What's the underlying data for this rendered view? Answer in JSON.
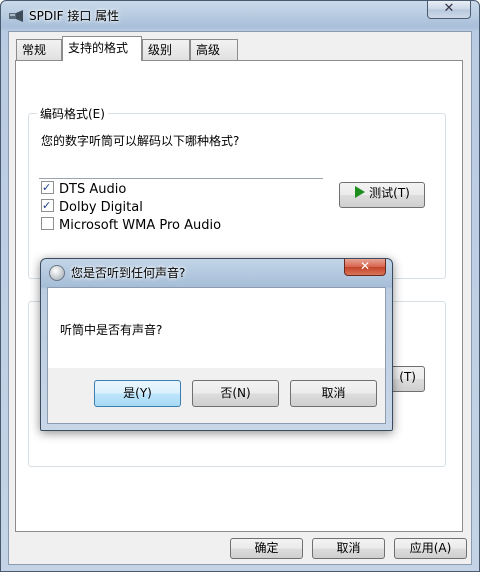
{
  "window": {
    "title": "SPDIF 接口 属性",
    "close_glyph": "✕"
  },
  "tabs": [
    {
      "label": "常规"
    },
    {
      "label": "支持的格式"
    },
    {
      "label": "级别"
    },
    {
      "label": "高级"
    }
  ],
  "encoding_group": {
    "label": "编码格式(E)",
    "prompt": "您的数字听筒可以解码以下哪种格式?",
    "formats": [
      {
        "label": "DTS Audio",
        "checked": true
      },
      {
        "label": "Dolby Digital",
        "checked": true
      },
      {
        "label": "Microsoft WMA Pro Audio",
        "checked": false
      }
    ],
    "test_button": "测试(T)"
  },
  "hidden_group": {
    "partial_button": "(T)"
  },
  "footer": {
    "ok": "确定",
    "cancel": "取消",
    "apply": "应用(A)"
  },
  "dialog": {
    "title": "您是否听到任何声音?",
    "message": "听筒中是否有声音?",
    "yes": "是(Y)",
    "no": "否(N)",
    "cancel": "取消",
    "close_glyph": "✕"
  },
  "colors": {
    "play_icon": "#1e8e1e",
    "dialog_close": "#c24428"
  }
}
